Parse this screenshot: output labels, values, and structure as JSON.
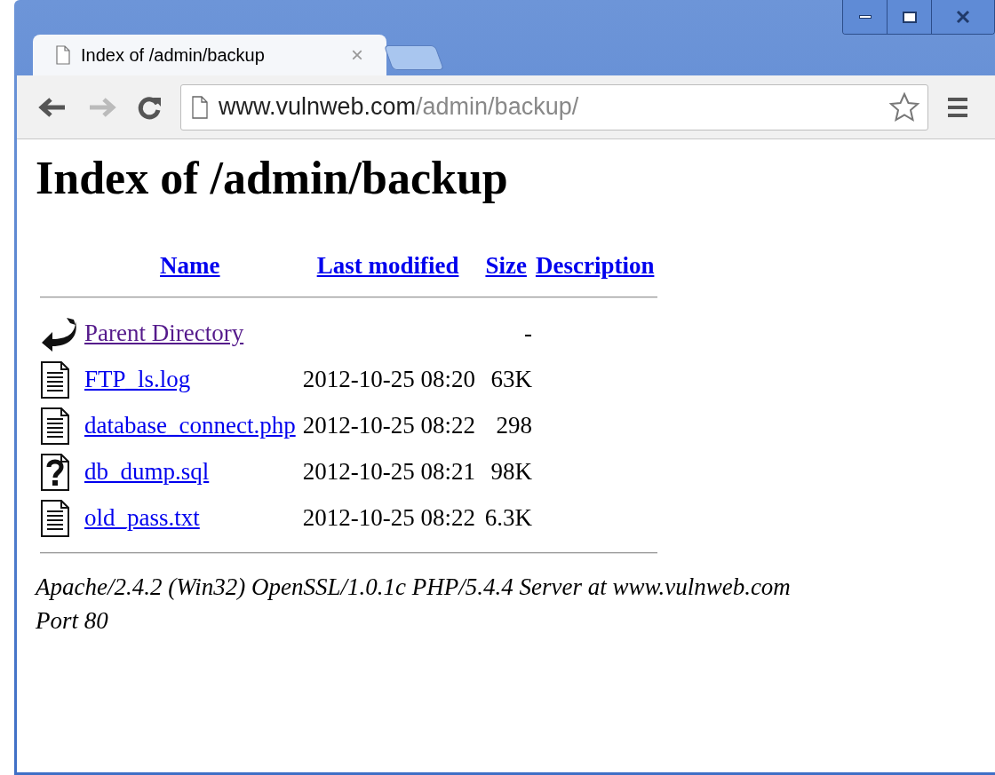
{
  "tab": {
    "title": "Index of /admin/backup",
    "close": "×"
  },
  "address": {
    "host": "www.vulnweb.com",
    "path": "/admin/backup/"
  },
  "heading": "Index of /admin/backup",
  "columns": [
    "Name",
    "Last modified",
    "Size",
    "Description"
  ],
  "rows": [
    {
      "kind": "back",
      "name": "Parent Directory",
      "visited": true,
      "modified": "",
      "size": "-"
    },
    {
      "kind": "text",
      "name": "FTP_ls.log",
      "visited": false,
      "modified": "2012-10-25 08:20",
      "size": "63K"
    },
    {
      "kind": "text",
      "name": "database_connect.php",
      "visited": false,
      "modified": "2012-10-25 08:22",
      "size": "298"
    },
    {
      "kind": "unknown",
      "name": "db_dump.sql",
      "visited": false,
      "modified": "2012-10-25 08:21",
      "size": "98K"
    },
    {
      "kind": "text",
      "name": "old_pass.txt",
      "visited": false,
      "modified": "2012-10-25 08:22",
      "size": "6.3K"
    }
  ],
  "footer": "Apache/2.4.2 (Win32) OpenSSL/1.0.1c PHP/5.4.4 Server at www.vulnweb.com Port 80"
}
